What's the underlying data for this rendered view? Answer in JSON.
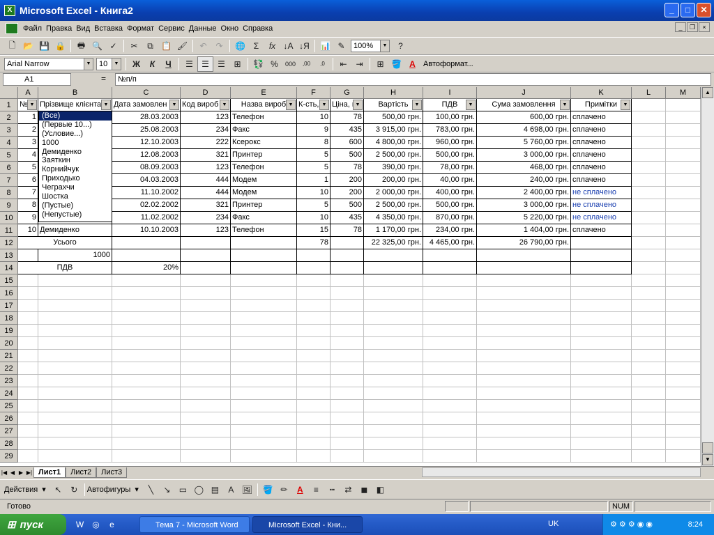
{
  "window": {
    "title": "Microsoft Excel - Книга2",
    "minimize": "_",
    "maximize": "□",
    "close": "✕"
  },
  "menu": [
    "Файл",
    "Правка",
    "Вид",
    "Вставка",
    "Формат",
    "Сервис",
    "Данные",
    "Окно",
    "Справка"
  ],
  "toolbar": {
    "zoom": "100%",
    "font": "Arial Narrow",
    "size": "10",
    "bold": "Ж",
    "italic": "К",
    "underline": "Ч",
    "autoformat": "Автоформат..."
  },
  "formula_bar": {
    "cell_ref": "A1",
    "fx": "=",
    "value": "№п/п"
  },
  "columns": [
    "A",
    "B",
    "C",
    "D",
    "E",
    "F",
    "G",
    "H",
    "I",
    "J",
    "K",
    "L",
    "M"
  ],
  "headers": [
    "№",
    "Прізвище клієнта",
    "Дата замовлен",
    "Код вироб",
    "Назва вироб",
    "К-сть,",
    "Ціна, г",
    "Вартість",
    "ПДВ",
    "Сума замовлення",
    "Примітки"
  ],
  "rows": [
    [
      "1",
      "",
      "28.03.2003",
      "123",
      "Телефон",
      "10",
      "78",
      "500,00 грн.",
      "100,00 грн.",
      "600,00 грн.",
      "сплачено"
    ],
    [
      "2",
      "",
      "25.08.2003",
      "234",
      "Факс",
      "9",
      "435",
      "3 915,00 грн.",
      "783,00 грн.",
      "4 698,00 грн.",
      "сплачено"
    ],
    [
      "3",
      "",
      "12.10.2003",
      "222",
      "Ксерокс",
      "8",
      "600",
      "4 800,00 грн.",
      "960,00 грн.",
      "5 760,00 грн.",
      "сплачено"
    ],
    [
      "4",
      "",
      "12.08.2003",
      "321",
      "Принтер",
      "5",
      "500",
      "2 500,00 грн.",
      "500,00 грн.",
      "3 000,00 грн.",
      "сплачено"
    ],
    [
      "5",
      "",
      "08.09.2003",
      "123",
      "Телефон",
      "5",
      "78",
      "390,00 грн.",
      "78,00 грн.",
      "468,00 грн.",
      "сплачено"
    ],
    [
      "6",
      "",
      "04.03.2003",
      "444",
      "Модем",
      "1",
      "200",
      "200,00 грн.",
      "40,00 грн.",
      "240,00 грн.",
      "сплачено"
    ],
    [
      "7",
      "",
      "11.10.2002",
      "444",
      "Модем",
      "10",
      "200",
      "2 000,00 грн.",
      "400,00 грн.",
      "2 400,00 грн.",
      "не сплачено"
    ],
    [
      "8",
      "",
      "02.02.2002",
      "321",
      "Принтер",
      "5",
      "500",
      "2 500,00 грн.",
      "500,00 грн.",
      "3 000,00 грн.",
      "не сплачено"
    ],
    [
      "9",
      "",
      "11.02.2002",
      "234",
      "Факс",
      "10",
      "435",
      "4 350,00 грн.",
      "870,00 грн.",
      "5 220,00 грн.",
      "не сплачено"
    ],
    [
      "10",
      "Демиденко",
      "10.10.2003",
      "123",
      "Телефон",
      "15",
      "78",
      "1 170,00 грн.",
      "234,00 грн.",
      "1 404,00 грн.",
      "сплачено"
    ]
  ],
  "totals": {
    "label": "Усього",
    "qty": "78",
    "cost": "22 325,00 грн.",
    "vat": "4 465,00 грн.",
    "sum": "26 790,00 грн."
  },
  "row13": {
    "value": "1000"
  },
  "row14": {
    "label": "ПДВ",
    "value": "20%"
  },
  "filter_dropdown": [
    "(Все)",
    "(Первые 10...)",
    "(Условие...)",
    "1000",
    "Демиденко",
    "Заяткин",
    "Корнийчук",
    "Приходько",
    "Чеграхчи",
    "Шостка",
    "(Пустые)",
    "(Непустые)"
  ],
  "sheet_tabs": [
    "Лист1",
    "Лист2",
    "Лист3"
  ],
  "drawing": {
    "actions": "Действия",
    "autoshapes": "Автофигуры"
  },
  "status": {
    "ready": "Готово",
    "num": "NUM"
  },
  "taskbar": {
    "start": "пуск",
    "word_task": "Тема 7 - Microsoft Word",
    "excel_task": "Microsoft Excel - Кни...",
    "lang": "UK",
    "time": "8:24"
  },
  "chart_data": {
    "type": "table",
    "columns": [
      "№",
      "Прізвище клієнта",
      "Дата замовлен",
      "Код вироб",
      "Назва вироб",
      "К-сть,",
      "Ціна, г",
      "Вартість",
      "ПДВ",
      "Сума замовлення",
      "Примітки"
    ],
    "rows": [
      [
        1,
        "",
        "28.03.2003",
        123,
        "Телефон",
        10,
        78,
        "500,00 грн.",
        "100,00 грн.",
        "600,00 грн.",
        "сплачено"
      ],
      [
        2,
        "",
        "25.08.2003",
        234,
        "Факс",
        9,
        435,
        "3 915,00 грн.",
        "783,00 грн.",
        "4 698,00 грн.",
        "сплачено"
      ],
      [
        3,
        "",
        "12.10.2003",
        222,
        "Ксерокс",
        8,
        600,
        "4 800,00 грн.",
        "960,00 грн.",
        "5 760,00 грн.",
        "сплачено"
      ],
      [
        4,
        "",
        "12.08.2003",
        321,
        "Принтер",
        5,
        500,
        "2 500,00 грн.",
        "500,00 грн.",
        "3 000,00 грн.",
        "сплачено"
      ],
      [
        5,
        "",
        "08.09.2003",
        123,
        "Телефон",
        5,
        78,
        "390,00 грн.",
        "78,00 грн.",
        "468,00 грн.",
        "сплачено"
      ],
      [
        6,
        "",
        "04.03.2003",
        444,
        "Модем",
        1,
        200,
        "200,00 грн.",
        "40,00 грн.",
        "240,00 грн.",
        "сплачено"
      ],
      [
        7,
        "",
        "11.10.2002",
        444,
        "Модем",
        10,
        200,
        "2 000,00 грн.",
        "400,00 грн.",
        "2 400,00 грн.",
        "не сплачено"
      ],
      [
        8,
        "",
        "02.02.2002",
        321,
        "Принтер",
        5,
        500,
        "2 500,00 грн.",
        "500,00 грн.",
        "3 000,00 грн.",
        "не сплачено"
      ],
      [
        9,
        "",
        "11.02.2002",
        234,
        "Факс",
        10,
        435,
        "4 350,00 грн.",
        "870,00 грн.",
        "5 220,00 грн.",
        "не сплачено"
      ],
      [
        10,
        "Демиденко",
        "10.10.2003",
        123,
        "Телефон",
        15,
        78,
        "1 170,00 грн.",
        "234,00 грн.",
        "1 404,00 грн.",
        "сплачено"
      ]
    ]
  }
}
